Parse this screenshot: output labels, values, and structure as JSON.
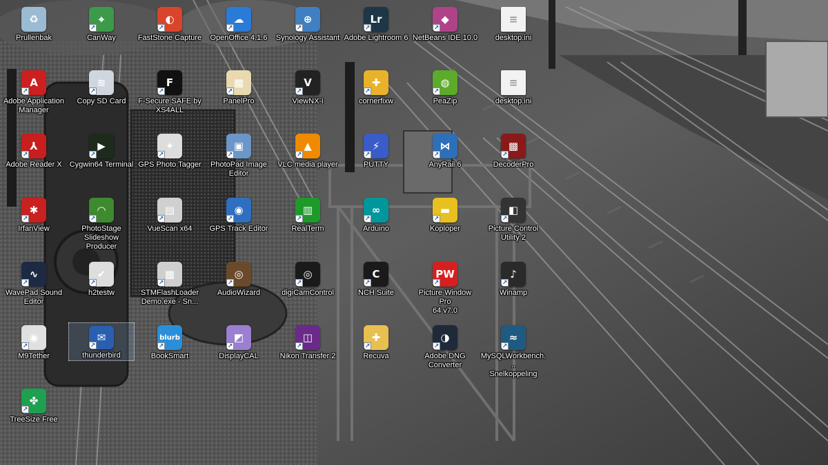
{
  "desktop": {
    "icons": [
      {
        "label": "Prullenbak",
        "icon": "recycle-bin-icon",
        "color": "#9bbbd4",
        "glyph": "♻",
        "shortcut": false
      },
      {
        "label": "CanWay",
        "icon": "map-pin-icon",
        "color": "#3c9a4a",
        "glyph": "⌖",
        "shortcut": true
      },
      {
        "label": "FastStone Capture",
        "icon": "faststone-capture-icon",
        "color": "#d9452b",
        "glyph": "◐",
        "shortcut": true
      },
      {
        "label": "OpenOffice 4.1.6",
        "icon": "openoffice-icon",
        "color": "#2a7ad8",
        "glyph": "☁",
        "shortcut": true
      },
      {
        "label": "Synology Assistant",
        "icon": "magnifier-icon",
        "color": "#3f7fc2",
        "glyph": "⊕",
        "shortcut": true
      },
      {
        "label": "Adobe Lightroom 6",
        "icon": "lightroom-icon",
        "color": "#1e3747",
        "glyph": "Lr",
        "shortcut": true
      },
      {
        "label": "NetBeans IDE 10.0",
        "icon": "netbeans-cube-icon",
        "color": "#b0428a",
        "glyph": "◆",
        "shortcut": true
      },
      {
        "label": "desktop.ini",
        "icon": "document-icon",
        "color": "#f2f2f2",
        "glyph": "≡",
        "shortcut": false
      },
      {
        "label": "Adobe Application\nManager",
        "icon": "adobe-icon",
        "color": "#cc1f1f",
        "glyph": "A",
        "shortcut": true
      },
      {
        "label": "Copy SD Card",
        "icon": "waves-icon",
        "color": "#cfd6de",
        "glyph": "≋",
        "shortcut": true
      },
      {
        "label": "F-Secure SAFE by\nXS4ALL",
        "icon": "f-secure-icon",
        "color": "#111111",
        "glyph": "F",
        "shortcut": true
      },
      {
        "label": "PanelPro",
        "icon": "panelpro-icon",
        "color": "#e8d9b0",
        "glyph": "▦",
        "shortcut": true
      },
      {
        "label": "ViewNX-i",
        "icon": "viewnx-icon",
        "color": "#222222",
        "glyph": "V",
        "shortcut": true
      },
      {
        "label": "cornerfixw",
        "icon": "cornerfix-icon",
        "color": "#e8b32a",
        "glyph": "✚",
        "shortcut": true
      },
      {
        "label": "PeaZip",
        "icon": "peazip-icon",
        "color": "#5cab2a",
        "glyph": "◍",
        "shortcut": true
      },
      {
        "label": "desktop.ini",
        "icon": "document-icon",
        "color": "#f2f2f2",
        "glyph": "≡",
        "shortcut": false
      },
      {
        "label": "Adobe Reader X",
        "icon": "adobe-reader-icon",
        "color": "#c81e1e",
        "glyph": "⅄",
        "shortcut": true
      },
      {
        "label": "Cygwin64 Terminal",
        "icon": "terminal-icon",
        "color": "#1d2b1d",
        "glyph": "▶",
        "shortcut": true
      },
      {
        "label": "GPS Photo Tagger",
        "icon": "compass-icon",
        "color": "#dddddd",
        "glyph": "✦",
        "shortcut": true
      },
      {
        "label": "PhotoPad Image\nEditor",
        "icon": "photopad-icon",
        "color": "#6a96c8",
        "glyph": "▣",
        "shortcut": true
      },
      {
        "label": "VLC media player",
        "icon": "vlc-cone-icon",
        "color": "#f08a00",
        "glyph": "▲",
        "shortcut": true
      },
      {
        "label": "PUTTY",
        "icon": "putty-icon",
        "color": "#3a5cc8",
        "glyph": "⚡",
        "shortcut": true
      },
      {
        "label": "AnyRail 6",
        "icon": "anyrail-icon",
        "color": "#2d6fb8",
        "glyph": "⋈",
        "shortcut": true
      },
      {
        "label": "DecoderPro",
        "icon": "decoderpro-icon",
        "color": "#8a1a1a",
        "glyph": "▩",
        "shortcut": true
      },
      {
        "label": "IrfanView",
        "icon": "irfanview-icon",
        "color": "#c92020",
        "glyph": "✱",
        "shortcut": true
      },
      {
        "label": "PhotoStage\nSlideshow Producer",
        "icon": "photostage-icon",
        "color": "#3d8a2f",
        "glyph": "◠",
        "shortcut": true
      },
      {
        "label": "VueScan x64",
        "icon": "scanner-icon",
        "color": "#d0d0d0",
        "glyph": "▤",
        "shortcut": true
      },
      {
        "label": "GPS Track Editor",
        "icon": "globe-icon",
        "color": "#2f6fc0",
        "glyph": "◉",
        "shortcut": true
      },
      {
        "label": "RealTerm",
        "icon": "realterm-icon",
        "color": "#1e9a2a",
        "glyph": "▥",
        "shortcut": true
      },
      {
        "label": "Arduino",
        "icon": "arduino-icon",
        "color": "#00979c",
        "glyph": "∞",
        "shortcut": true
      },
      {
        "label": "Koploper",
        "icon": "train-icon",
        "color": "#e8c020",
        "glyph": "▬",
        "shortcut": true
      },
      {
        "label": "Picture Control\nUtility 2",
        "icon": "picture-control-icon",
        "color": "#333333",
        "glyph": "◧",
        "shortcut": true
      },
      {
        "label": "WavePad Sound\nEditor",
        "icon": "waveform-icon",
        "color": "#1c2a44",
        "glyph": "∿",
        "shortcut": true
      },
      {
        "label": "h2testw",
        "icon": "checkmark-icon",
        "color": "#dddddd",
        "glyph": "✔",
        "shortcut": true
      },
      {
        "label": "STMFlashLoader\nDemo.exe - Sn...",
        "icon": "chip-icon",
        "color": "#cfcfcf",
        "glyph": "▦",
        "shortcut": true
      },
      {
        "label": "AudioWizard",
        "icon": "speaker-icon",
        "color": "#6a4a2a",
        "glyph": "◎",
        "shortcut": true
      },
      {
        "label": "digiCamControl",
        "icon": "camera-aperture-icon",
        "color": "#1a1a1a",
        "glyph": "◎",
        "shortcut": true
      },
      {
        "label": "NCH Suite",
        "icon": "nch-icon",
        "color": "#1a1a1a",
        "glyph": "C",
        "shortcut": true
      },
      {
        "label": "Picture Window Pro\n64 v7.0",
        "icon": "picture-window-icon",
        "color": "#d62020",
        "glyph": "PW",
        "shortcut": true
      },
      {
        "label": "Winamp",
        "icon": "winamp-icon",
        "color": "#2a2a2a",
        "glyph": "♪",
        "shortcut": true
      },
      {
        "label": "M9Tether",
        "icon": "m9tether-icon",
        "color": "#e0e0e0",
        "glyph": "◉",
        "shortcut": true
      },
      {
        "label": "thunderbird",
        "icon": "thunderbird-icon",
        "color": "#2a5fb0",
        "glyph": "✉",
        "shortcut": true
      },
      {
        "label": "BookSmart",
        "icon": "blurb-icon",
        "color": "#2a8fd8",
        "glyph": "blurb",
        "shortcut": true
      },
      {
        "label": "DisplayCAL",
        "icon": "displaycal-icon",
        "color": "#9b7fd0",
        "glyph": "◩",
        "shortcut": true
      },
      {
        "label": "Nikon Transfer 2",
        "icon": "nikon-transfer-icon",
        "color": "#6a2a8a",
        "glyph": "◫",
        "shortcut": true
      },
      {
        "label": "Recuva",
        "icon": "recuva-icon",
        "color": "#e8c050",
        "glyph": "✚",
        "shortcut": true
      },
      {
        "label": "Adobe DNG\nConverter",
        "icon": "dng-converter-icon",
        "color": "#1e2a3a",
        "glyph": "◑",
        "shortcut": true
      },
      {
        "label": "MySQLWorkbench...\nSnelkoppeling",
        "icon": "mysql-dolphin-icon",
        "color": "#1f5a82",
        "glyph": "≈",
        "shortcut": true
      },
      {
        "label": "TreeSize Free",
        "icon": "treesize-icon",
        "color": "#1ea050",
        "glyph": "✤",
        "shortcut": true
      }
    ]
  }
}
